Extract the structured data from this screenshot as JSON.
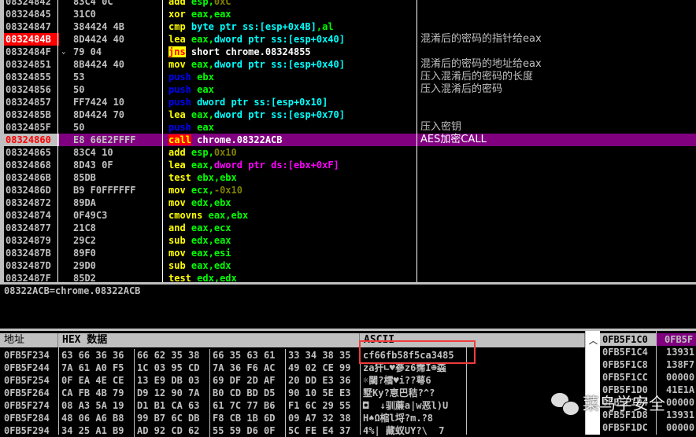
{
  "colors": {
    "mnem": "#ffff00",
    "push": "#0000ff",
    "reg": "#00ff00",
    "mem": "#00ffff",
    "const": "#808000",
    "target": "#ffffff",
    "dsmem": "#ff00ff",
    "callrow": "#800080",
    "bp": "#ff0000"
  },
  "disasm": [
    {
      "addr": "08324842",
      "hex": "83C4 0C",
      "mn": "add",
      "ops": [
        [
          "esp",
          "reg"
        ],
        [
          ",",
          "reg"
        ],
        [
          "0xC",
          "const"
        ]
      ]
    },
    {
      "addr": "08324845",
      "hex": "31C0",
      "mn": "xor",
      "ops": [
        [
          "eax",
          "reg"
        ],
        [
          ",",
          "reg"
        ],
        [
          "eax",
          "reg"
        ]
      ]
    },
    {
      "addr": "08324847",
      "hex": "384424 4B",
      "mn": "cmp",
      "ops": [
        [
          "byte ptr ss:[esp+0x4B]",
          "mem"
        ],
        [
          ",",
          "reg"
        ],
        [
          "al",
          "reg"
        ]
      ]
    },
    {
      "addr": "0832484B",
      "hex": "8D4424 40",
      "mn": "lea",
      "bp": true,
      "ops": [
        [
          "eax",
          "reg"
        ],
        [
          ",",
          "reg"
        ],
        [
          "dword ptr ss:[esp+0x40]",
          "mem"
        ]
      ],
      "comment": "混淆后的密码的指针给eax"
    },
    {
      "addr": "0832484F",
      "hex": "79 04",
      "mn": "jns",
      "jump": true,
      "mark": "⌄",
      "ops": [
        [
          "short chrome.08324855",
          "target"
        ]
      ]
    },
    {
      "addr": "08324851",
      "hex": "8B4424 40",
      "mn": "mov",
      "ops": [
        [
          "eax",
          "reg"
        ],
        [
          ",",
          "reg"
        ],
        [
          "dword ptr ss:[esp+0x40]",
          "mem"
        ]
      ],
      "comment": "混淆后的密码的地址给eax"
    },
    {
      "addr": "08324855",
      "hex": "53",
      "mn": "push",
      "push": true,
      "ops": [
        [
          "ebx",
          "reg"
        ]
      ],
      "comment": "压入混淆后的密码的长度"
    },
    {
      "addr": "08324856",
      "hex": "50",
      "mn": "push",
      "push": true,
      "ops": [
        [
          "eax",
          "reg"
        ]
      ],
      "comment": "压入混淆后的密码"
    },
    {
      "addr": "08324857",
      "hex": "FF7424 10",
      "mn": "push",
      "push": true,
      "ops": [
        [
          "dword ptr ss:[esp+0x10]",
          "mem"
        ]
      ]
    },
    {
      "addr": "0832485B",
      "hex": "8D4424 70",
      "mn": "lea",
      "ops": [
        [
          "eax",
          "reg"
        ],
        [
          ",",
          "reg"
        ],
        [
          "dword ptr ss:[esp+0x70]",
          "mem"
        ]
      ]
    },
    {
      "addr": "0832485F",
      "hex": "50",
      "mn": "push",
      "push": true,
      "ops": [
        [
          "eax",
          "reg"
        ]
      ],
      "comment": "压入密钥"
    },
    {
      "addr": "08324860",
      "hex": "E8 66E2FFFF",
      "mn": "call",
      "call": true,
      "ops": [
        [
          "chrome.08322ACB",
          "target"
        ]
      ],
      "comment": "AES加密CALL"
    },
    {
      "addr": "08324865",
      "hex": "83C4 10",
      "mn": "add",
      "ops": [
        [
          "esp",
          "reg"
        ],
        [
          ",",
          "reg"
        ],
        [
          "0x10",
          "const"
        ]
      ]
    },
    {
      "addr": "08324868",
      "hex": "8D43 0F",
      "mn": "lea",
      "ops": [
        [
          "eax",
          "reg"
        ],
        [
          ",",
          "reg"
        ],
        [
          "dword ptr ds:[ebx+0xF]",
          "dsmem"
        ]
      ]
    },
    {
      "addr": "0832486B",
      "hex": "85DB",
      "mn": "test",
      "ops": [
        [
          "ebx",
          "reg"
        ],
        [
          ",",
          "reg"
        ],
        [
          "ebx",
          "reg"
        ]
      ]
    },
    {
      "addr": "0832486D",
      "hex": "B9 F0FFFFFF",
      "mn": "mov",
      "ops": [
        [
          "ecx",
          "reg"
        ],
        [
          ",",
          "reg"
        ],
        [
          "-0x10",
          "const"
        ]
      ]
    },
    {
      "addr": "08324872",
      "hex": "89DA",
      "mn": "mov",
      "ops": [
        [
          "edx",
          "reg"
        ],
        [
          ",",
          "reg"
        ],
        [
          "ebx",
          "reg"
        ]
      ]
    },
    {
      "addr": "08324874",
      "hex": "0F49C3",
      "mn": "cmovns",
      "ops": [
        [
          "eax",
          "reg"
        ],
        [
          ",",
          "reg"
        ],
        [
          "ebx",
          "reg"
        ]
      ]
    },
    {
      "addr": "08324877",
      "hex": "21C8",
      "mn": "and",
      "ops": [
        [
          "eax",
          "reg"
        ],
        [
          ",",
          "reg"
        ],
        [
          "ecx",
          "reg"
        ]
      ]
    },
    {
      "addr": "08324879",
      "hex": "29C2",
      "mn": "sub",
      "ops": [
        [
          "edx",
          "reg"
        ],
        [
          ",",
          "reg"
        ],
        [
          "eax",
          "reg"
        ]
      ]
    },
    {
      "addr": "0832487B",
      "hex": "89F0",
      "mn": "mov",
      "ops": [
        [
          "eax",
          "reg"
        ],
        [
          ",",
          "reg"
        ],
        [
          "esi",
          "reg"
        ]
      ]
    },
    {
      "addr": "0832487D",
      "hex": "29D0",
      "mn": "sub",
      "ops": [
        [
          "eax",
          "reg"
        ],
        [
          ",",
          "reg"
        ],
        [
          "edx",
          "reg"
        ]
      ]
    },
    {
      "addr": "0832487F",
      "hex": "85D2",
      "mn": "test",
      "ops": [
        [
          "edx",
          "reg"
        ],
        [
          ",",
          "reg"
        ],
        [
          "edx",
          "reg"
        ]
      ]
    }
  ],
  "info": "08322ACB=chrome.08322ACB",
  "dump": {
    "headers": {
      "addr": "地址",
      "hex": "HEX 数据",
      "ascii": "ASCII"
    },
    "rows": [
      {
        "addr": "0FB5F234",
        "bytes": [
          "63 66 36 36",
          "66 62 35 38",
          "66 35 63 61",
          "33 34 38 35"
        ],
        "ascii": "cf66fb58f5ca3485"
      },
      {
        "addr": "0FB5F244",
        "bytes": [
          "7A 61 A0 F5",
          "1C 03 95 CD",
          "7A 36 F6 AC",
          "49 02 CE 99"
        ],
        "ascii": "za犴∟♥嵾z6霈I☻螙"
      },
      {
        "addr": "0FB5F254",
        "bytes": [
          "0F EA 4E CE",
          "13 E9 DB 03",
          "69 DF 2D AF",
          "20 DD E3 36"
        ],
        "ascii": "☼闚?檑♥i??萼6"
      },
      {
        "addr": "0FB5F264",
        "bytes": [
          "CA FB 4B 79",
          "D9 12 90 7A",
          "B0 CD BD D5",
          "90 10 5E E3"
        ],
        "ascii": "墅Ky?恴巴秸?^?"
      },
      {
        "addr": "0FB5F274",
        "bytes": [
          "08 A3 5A 19",
          "D1 B1 CA 63",
          "61 7C 77 B6",
          "F1 6C 29 55"
        ],
        "ascii": "◘  ↓驯薕a|w恶l)U"
      },
      {
        "addr": "0FB5F284",
        "bytes": [
          "48 06 A6 B8",
          "99 B7 6C DB",
          "F8 CB 1B 6D",
          "09 A7 32 38"
        ],
        "ascii": "H♠Ω樎l埒?m.?8"
      },
      {
        "addr": "0FB5F294",
        "bytes": [
          "34 25 A1 B9",
          "AD 92 CD 62",
          "55 59 D6 0F",
          "5C FE E4 37"
        ],
        "ascii": "4%| 藏蚁UY?\\  7"
      }
    ]
  },
  "stack": [
    {
      "addr": "0FB5F1C0",
      "val": "0FB5F"
    },
    {
      "addr": "0FB5F1C4",
      "val": "13931"
    },
    {
      "addr": "0FB5F1C8",
      "val": "138F7"
    },
    {
      "addr": "0FB5F1CC",
      "val": "00000"
    },
    {
      "addr": "0FB5F1D0",
      "val": "41E1A"
    },
    {
      "addr": "0FB5F1D4",
      "val": "00000"
    },
    {
      "addr": "0FB5F1D8",
      "val": "13931"
    },
    {
      "addr": "0FB5F1DC",
      "val": "00000"
    }
  ],
  "watermark": "菜鸟学安全"
}
